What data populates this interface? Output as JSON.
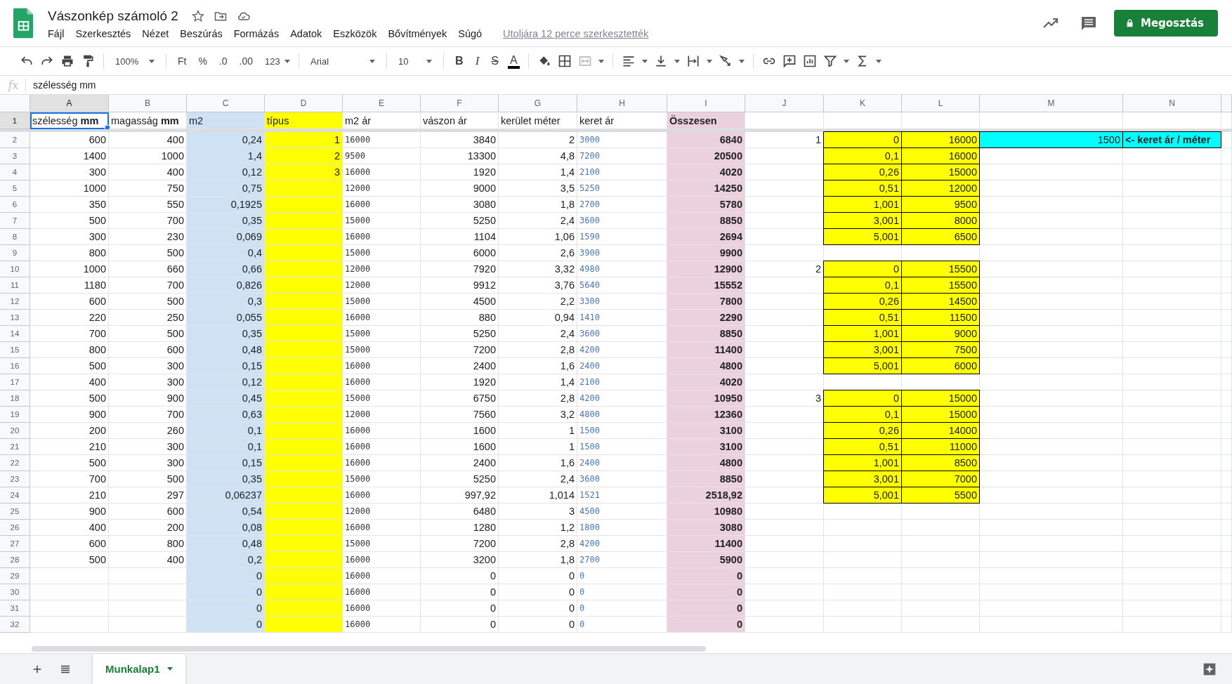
{
  "document": {
    "title": "Vászonkép számoló 2",
    "last_edit": "Utoljára 12 perce szerkesztették"
  },
  "menus": [
    "Fájl",
    "Szerkesztés",
    "Nézet",
    "Beszúrás",
    "Formázás",
    "Adatok",
    "Eszközök",
    "Bővítmények",
    "Súgó"
  ],
  "share_button": "Megosztás",
  "toolbar": {
    "zoom": "100%",
    "currency": "Ft",
    "percent": "%",
    "decrease_decimals": ".0",
    "increase_decimals": ".00",
    "number_format": "123",
    "font": "Arial",
    "font_size": "10",
    "bold": "B",
    "italic": "I",
    "strikethrough": "S",
    "text_color": "A"
  },
  "formula_bar": {
    "label": "fx",
    "value": "szélesség mm"
  },
  "columns": [
    {
      "letter": "A",
      "selected": true,
      "kind": "number"
    },
    {
      "letter": "B",
      "selected": false,
      "kind": "number"
    },
    {
      "letter": "C",
      "selected": false,
      "kind": "number",
      "color": "#cfe2f3"
    },
    {
      "letter": "D",
      "selected": false,
      "kind": "number",
      "color": "#ffff00"
    },
    {
      "letter": "E",
      "selected": false,
      "kind": "code"
    },
    {
      "letter": "F",
      "selected": false,
      "kind": "number"
    },
    {
      "letter": "G",
      "selected": false,
      "kind": "number"
    },
    {
      "letter": "H",
      "selected": false,
      "kind": "ref"
    },
    {
      "letter": "I",
      "selected": false,
      "kind": "total",
      "color": "#ead1dc"
    },
    {
      "letter": "J",
      "selected": false,
      "kind": "number"
    },
    {
      "letter": "K",
      "selected": false,
      "kind": "number"
    },
    {
      "letter": "L",
      "selected": false,
      "kind": "number"
    },
    {
      "letter": "M",
      "selected": false,
      "kind": "number"
    },
    {
      "letter": "N",
      "selected": false,
      "kind": "text"
    }
  ],
  "rows": [
    {
      "number": "1",
      "selected": true,
      "kind": "header",
      "cells": {
        "A": "szélesség **mm**",
        "B": "magasság **mm**",
        "C": "m2",
        "D": "típus",
        "E": "m2 ár",
        "F": "vászon ár",
        "G": "kerület méter",
        "H": "keret ár",
        "I": "Összesen"
      }
    },
    {
      "number": "2",
      "selected": false,
      "kind": "data",
      "cells": {
        "A": "600",
        "B": "400",
        "C": "0,24",
        "D": "1",
        "E": "16000",
        "F": "3840",
        "G": "2",
        "H": "3000",
        "I": "6840",
        "J": "1",
        "K": {
          "text": "0",
          "color": "#ffff00"
        },
        "L": {
          "text": "16000",
          "color": "#ffff00"
        },
        "M": {
          "text": "1500",
          "color": "#00ffff"
        },
        "N": {
          "text": "<- keret ár / méter",
          "color": "#00ffff",
          "bold": true
        }
      }
    },
    {
      "number": "3",
      "selected": false,
      "kind": "data",
      "cells": {
        "A": "1400",
        "B": "1000",
        "C": "1,4",
        "D": "2",
        "E": "9500",
        "F": "13300",
        "G": "4,8",
        "H": "7200",
        "I": "20500",
        "K": {
          "text": "0,1",
          "color": "#ffff00"
        },
        "L": {
          "text": "16000",
          "color": "#ffff00"
        }
      }
    },
    {
      "number": "4",
      "selected": false,
      "kind": "data",
      "cells": {
        "A": "300",
        "B": "400",
        "C": "0,12",
        "D": "3",
        "E": "16000",
        "F": "1920",
        "G": "1,4",
        "H": "2100",
        "I": "4020",
        "K": {
          "text": "0,26",
          "color": "#ffff00"
        },
        "L": {
          "text": "15000",
          "color": "#ffff00"
        }
      }
    },
    {
      "number": "5",
      "selected": false,
      "kind": "data",
      "cells": {
        "A": "1000",
        "B": "750",
        "C": "0,75",
        "E": "12000",
        "F": "9000",
        "G": "3,5",
        "H": "5250",
        "I": "14250",
        "K": {
          "text": "0,51",
          "color": "#ffff00"
        },
        "L": {
          "text": "12000",
          "color": "#ffff00"
        }
      }
    },
    {
      "number": "6",
      "selected": false,
      "kind": "data",
      "cells": {
        "A": "350",
        "B": "550",
        "C": "0,1925",
        "E": "16000",
        "F": "3080",
        "G": "1,8",
        "H": "2700",
        "I": "5780",
        "K": {
          "text": "1,001",
          "color": "#ffff00"
        },
        "L": {
          "text": "9500",
          "color": "#ffff00"
        }
      }
    },
    {
      "number": "7",
      "selected": false,
      "kind": "data",
      "cells": {
        "A": "500",
        "B": "700",
        "C": "0,35",
        "E": "15000",
        "F": "5250",
        "G": "2,4",
        "H": "3600",
        "I": "8850",
        "K": {
          "text": "3,001",
          "color": "#ffff00"
        },
        "L": {
          "text": "8000",
          "color": "#ffff00"
        }
      }
    },
    {
      "number": "8",
      "selected": false,
      "kind": "data",
      "cells": {
        "A": "300",
        "B": "230",
        "C": "0,069",
        "E": "16000",
        "F": "1104",
        "G": "1,06",
        "H": "1590",
        "I": "2694",
        "K": {
          "text": "5,001",
          "color": "#ffff00"
        },
        "L": {
          "text": "6500",
          "color": "#ffff00"
        }
      }
    },
    {
      "number": "9",
      "selected": false,
      "kind": "data",
      "cells": {
        "A": "800",
        "B": "500",
        "C": "0,4",
        "E": "15000",
        "F": "6000",
        "G": "2,6",
        "H": "3900",
        "I": "9900"
      }
    },
    {
      "number": "10",
      "selected": false,
      "kind": "data",
      "cells": {
        "A": "1000",
        "B": "660",
        "C": "0,66",
        "E": "12000",
        "F": "7920",
        "G": "3,32",
        "H": "4980",
        "I": "12900",
        "J": "2",
        "K": {
          "text": "0",
          "color": "#ffff00"
        },
        "L": {
          "text": "15500",
          "color": "#ffff00"
        }
      }
    },
    {
      "number": "11",
      "selected": false,
      "kind": "data",
      "cells": {
        "A": "1180",
        "B": "700",
        "C": "0,826",
        "E": "12000",
        "F": "9912",
        "G": "3,76",
        "H": "5640",
        "I": "15552",
        "K": {
          "text": "0,1",
          "color": "#ffff00"
        },
        "L": {
          "text": "15500",
          "color": "#ffff00"
        }
      }
    },
    {
      "number": "12",
      "selected": false,
      "kind": "data",
      "cells": {
        "A": "600",
        "B": "500",
        "C": "0,3",
        "E": "15000",
        "F": "4500",
        "G": "2,2",
        "H": "3300",
        "I": "7800",
        "K": {
          "text": "0,26",
          "color": "#ffff00"
        },
        "L": {
          "text": "14500",
          "color": "#ffff00"
        }
      }
    },
    {
      "number": "13",
      "selected": false,
      "kind": "data",
      "cells": {
        "A": "220",
        "B": "250",
        "C": "0,055",
        "E": "16000",
        "F": "880",
        "G": "0,94",
        "H": "1410",
        "I": "2290",
        "K": {
          "text": "0,51",
          "color": "#ffff00"
        },
        "L": {
          "text": "11500",
          "color": "#ffff00"
        }
      }
    },
    {
      "number": "14",
      "selected": false,
      "kind": "data",
      "cells": {
        "A": "700",
        "B": "500",
        "C": "0,35",
        "E": "15000",
        "F": "5250",
        "G": "2,4",
        "H": "3600",
        "I": "8850",
        "K": {
          "text": "1,001",
          "color": "#ffff00"
        },
        "L": {
          "text": "9000",
          "color": "#ffff00"
        }
      }
    },
    {
      "number": "15",
      "selected": false,
      "kind": "data",
      "cells": {
        "A": "800",
        "B": "600",
        "C": "0,48",
        "E": "15000",
        "F": "7200",
        "G": "2,8",
        "H": "4200",
        "I": "11400",
        "K": {
          "text": "3,001",
          "color": "#ffff00"
        },
        "L": {
          "text": "7500",
          "color": "#ffff00"
        }
      }
    },
    {
      "number": "16",
      "selected": false,
      "kind": "data",
      "cells": {
        "A": "500",
        "B": "300",
        "C": "0,15",
        "E": "16000",
        "F": "2400",
        "G": "1,6",
        "H": "2400",
        "I": "4800",
        "K": {
          "text": "5,001",
          "color": "#ffff00"
        },
        "L": {
          "text": "6000",
          "color": "#ffff00"
        }
      }
    },
    {
      "number": "17",
      "selected": false,
      "kind": "data",
      "cells": {
        "A": "400",
        "B": "300",
        "C": "0,12",
        "E": "16000",
        "F": "1920",
        "G": "1,4",
        "H": "2100",
        "I": "4020"
      }
    },
    {
      "number": "18",
      "selected": false,
      "kind": "data",
      "cells": {
        "A": "500",
        "B": "900",
        "C": "0,45",
        "E": "15000",
        "F": "6750",
        "G": "2,8",
        "H": "4200",
        "I": "10950",
        "J": "3",
        "K": {
          "text": "0",
          "color": "#ffff00"
        },
        "L": {
          "text": "15000",
          "color": "#ffff00"
        }
      }
    },
    {
      "number": "19",
      "selected": false,
      "kind": "data",
      "cells": {
        "A": "900",
        "B": "700",
        "C": "0,63",
        "E": "12000",
        "F": "7560",
        "G": "3,2",
        "H": "4800",
        "I": "12360",
        "K": {
          "text": "0,1",
          "color": "#ffff00"
        },
        "L": {
          "text": "15000",
          "color": "#ffff00"
        }
      }
    },
    {
      "number": "20",
      "selected": false,
      "kind": "data",
      "cells": {
        "A": "200",
        "B": "260",
        "C": "0,1",
        "E": "16000",
        "F": "1600",
        "G": "1",
        "H": "1500",
        "I": "3100",
        "K": {
          "text": "0,26",
          "color": "#ffff00"
        },
        "L": {
          "text": "14000",
          "color": "#ffff00"
        }
      }
    },
    {
      "number": "21",
      "selected": false,
      "kind": "data",
      "cells": {
        "A": "210",
        "B": "300",
        "C": "0,1",
        "E": "16000",
        "F": "1600",
        "G": "1",
        "H": "1500",
        "I": "3100",
        "K": {
          "text": "0,51",
          "color": "#ffff00"
        },
        "L": {
          "text": "11000",
          "color": "#ffff00"
        }
      }
    },
    {
      "number": "22",
      "selected": false,
      "kind": "data",
      "cells": {
        "A": "500",
        "B": "300",
        "C": "0,15",
        "E": "16000",
        "F": "2400",
        "G": "1,6",
        "H": "2400",
        "I": "4800",
        "K": {
          "text": "1,001",
          "color": "#ffff00"
        },
        "L": {
          "text": "8500",
          "color": "#ffff00"
        }
      }
    },
    {
      "number": "23",
      "selected": false,
      "kind": "data",
      "cells": {
        "A": "700",
        "B": "500",
        "C": "0,35",
        "E": "15000",
        "F": "5250",
        "G": "2,4",
        "H": "3600",
        "I": "8850",
        "K": {
          "text": "3,001",
          "color": "#ffff00"
        },
        "L": {
          "text": "7000",
          "color": "#ffff00"
        }
      }
    },
    {
      "number": "24",
      "selected": false,
      "kind": "data",
      "cells": {
        "A": "210",
        "B": "297",
        "C": "0,06237",
        "E": "16000",
        "F": "997,92",
        "G": "1,014",
        "H": "1521",
        "I": "2518,92",
        "K": {
          "text": "5,001",
          "color": "#ffff00"
        },
        "L": {
          "text": "5500",
          "color": "#ffff00"
        }
      }
    },
    {
      "number": "25",
      "selected": false,
      "kind": "data",
      "cells": {
        "A": "900",
        "B": "600",
        "C": "0,54",
        "E": "12000",
        "F": "6480",
        "G": "3",
        "H": "4500",
        "I": "10980"
      }
    },
    {
      "number": "26",
      "selected": false,
      "kind": "data",
      "cells": {
        "A": "400",
        "B": "200",
        "C": "0,08",
        "E": "16000",
        "F": "1280",
        "G": "1,2",
        "H": "1800",
        "I": "3080"
      }
    },
    {
      "number": "27",
      "selected": false,
      "kind": "data",
      "cells": {
        "A": "600",
        "B": "800",
        "C": "0,48",
        "E": "15000",
        "F": "7200",
        "G": "2,8",
        "H": "4200",
        "I": "11400"
      }
    },
    {
      "number": "28",
      "selected": false,
      "kind": "data",
      "cells": {
        "A": "500",
        "B": "400",
        "C": "0,2",
        "E": "16000",
        "F": "3200",
        "G": "1,8",
        "H": "2700",
        "I": "5900"
      }
    },
    {
      "number": "29",
      "selected": false,
      "kind": "data",
      "cells": {
        "C": "0",
        "E": "16000",
        "F": "0",
        "G": "0",
        "H": "0",
        "I": "0"
      }
    },
    {
      "number": "30",
      "selected": false,
      "kind": "data",
      "cells": {
        "C": "0",
        "E": "16000",
        "F": "0",
        "G": "0",
        "H": "0",
        "I": "0"
      }
    },
    {
      "number": "31",
      "selected": false,
      "kind": "data",
      "cells": {
        "C": "0",
        "E": "16000",
        "F": "0",
        "G": "0",
        "H": "0",
        "I": "0"
      }
    },
    {
      "number": "32",
      "selected": false,
      "kind": "data",
      "cells": {
        "C": "0",
        "E": "16000",
        "F": "0",
        "G": "0",
        "H": "0",
        "I": "0"
      }
    }
  ],
  "sheets": [
    {
      "name": "Munkalap1",
      "selected": true
    }
  ]
}
